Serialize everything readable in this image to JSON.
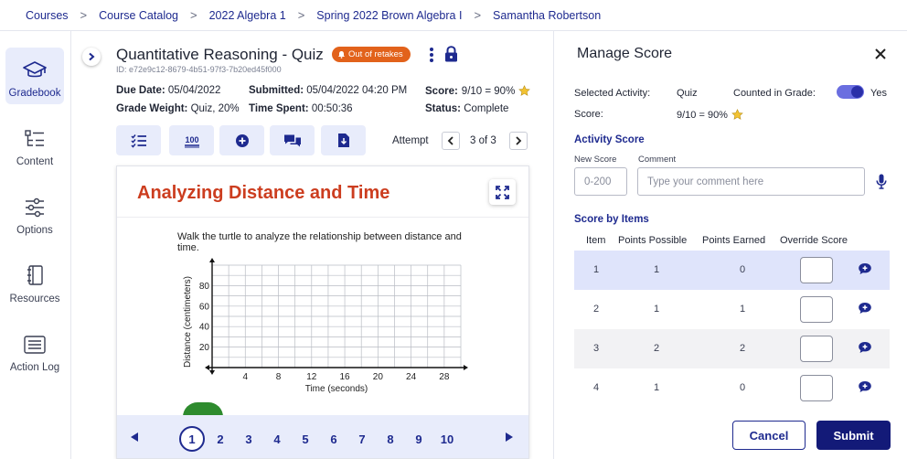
{
  "breadcrumb": [
    "Courses",
    "Course Catalog",
    "2022 Algebra 1",
    "Spring 2022 Brown Algebra I",
    "Samantha Robertson"
  ],
  "nav": [
    {
      "label": "Gradebook",
      "icon": "graduation-cap-icon",
      "active": true
    },
    {
      "label": "Content",
      "icon": "content-list-icon",
      "active": false
    },
    {
      "label": "Options",
      "icon": "sliders-icon",
      "active": false
    },
    {
      "label": "Resources",
      "icon": "binder-icon",
      "active": false
    },
    {
      "label": "Action Log",
      "icon": "log-icon",
      "active": false
    }
  ],
  "activity": {
    "title": "Quantitative Reasoning - Quiz",
    "badge": "Out of retakes",
    "id": "ID: e72e9c12-8679-4b51-97f3-7b20ed45f000",
    "due_label": "Due Date:",
    "due_value": "05/04/2022",
    "submitted_label": "Submitted:",
    "submitted_value": "05/04/2022 04:20 PM",
    "score_label": "Score:",
    "score_value": "9/10 = 90%",
    "weight_label": "Grade Weight:",
    "weight_value": "Quiz, 20%",
    "time_label": "Time Spent:",
    "time_value": "00:50:36",
    "status_label": "Status:",
    "status_value": "Complete"
  },
  "toolbar": {
    "tools": [
      "checklist-icon",
      "score-100-icon",
      "add-circle-icon",
      "comments-icon",
      "download-file-icon"
    ],
    "attempt_label": "Attempt",
    "attempt_value": "3 of 3"
  },
  "question": {
    "title": "Analyzing Distance and Time",
    "text": "Walk the turtle to analyze the relationship between distance and time.",
    "graph": {
      "ylabel": "Distance (centimeters)",
      "xlabel": "Time (seconds)",
      "yticks": [
        "20",
        "40",
        "60",
        "80"
      ],
      "xticks": [
        "4",
        "8",
        "12",
        "16",
        "20",
        "24",
        "28"
      ]
    }
  },
  "pager": {
    "pages": [
      "1",
      "2",
      "3",
      "4",
      "5",
      "6",
      "7",
      "8",
      "9",
      "10"
    ],
    "current": "1"
  },
  "manage": {
    "title": "Manage Score",
    "selected_activity_label": "Selected Activity:",
    "selected_activity_value": "Quiz",
    "counted_label": "Counted in Grade:",
    "counted_value": "Yes",
    "score_label": "Score:",
    "score_value": "9/10 = 90%",
    "activity_score_title": "Activity Score",
    "new_score_label": "New Score",
    "new_score_placeholder": "0-200",
    "comment_label": "Comment",
    "comment_placeholder": "Type your comment here",
    "by_items_title": "Score by Items",
    "headers": [
      "Item",
      "Points Possible",
      "Points Earned",
      "Override Score"
    ],
    "rows": [
      {
        "item": "1",
        "possible": "1",
        "earned": "0"
      },
      {
        "item": "2",
        "possible": "1",
        "earned": "1"
      },
      {
        "item": "3",
        "possible": "2",
        "earned": "2"
      },
      {
        "item": "4",
        "possible": "1",
        "earned": "0"
      }
    ],
    "cancel_label": "Cancel",
    "submit_label": "Submit"
  },
  "colors": {
    "accent": "#1e2a8f",
    "badge": "#e2621b",
    "title_red": "#cc3d1f",
    "highlight_row": "#dfe4fb",
    "striped_row": "#f2f2f4"
  }
}
